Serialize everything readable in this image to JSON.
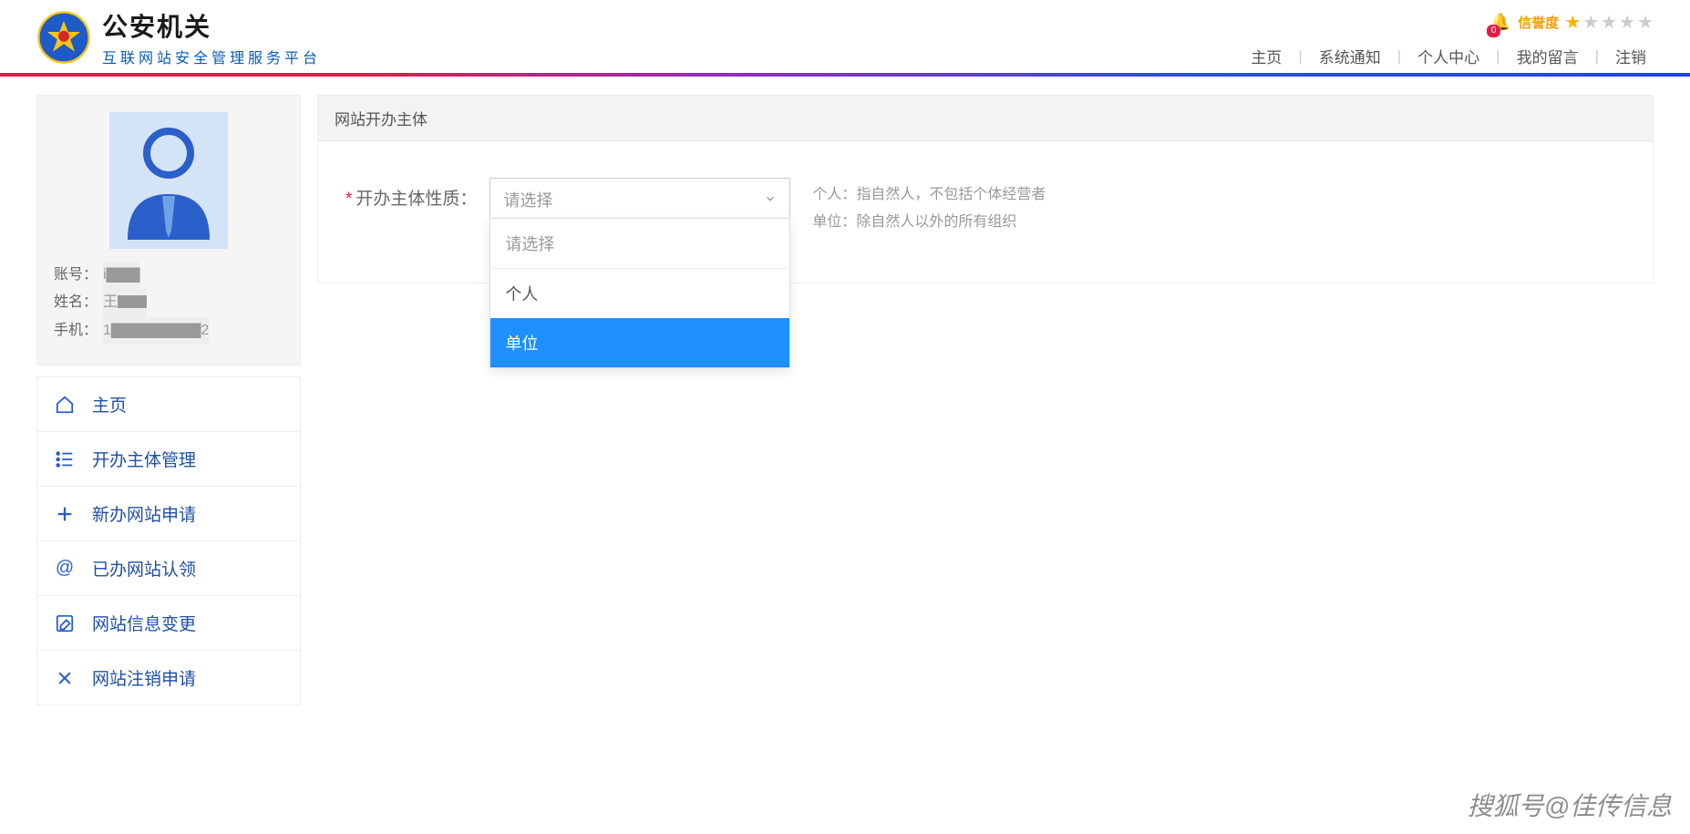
{
  "header": {
    "title": "公安机关",
    "subtitle": "互联网站安全管理服务平台",
    "credit_label": "信誉度",
    "badge_count": "0",
    "nav": [
      "主页",
      "系统通知",
      "个人中心",
      "我的留言",
      "注销"
    ]
  },
  "user": {
    "account_label": "账号：",
    "account_value": "i▇▇▇",
    "name_label": "姓名：",
    "name_value": "王▇▇",
    "phone_label": "手机：",
    "phone_value": "1▇▇▇▇▇▇▇▇2"
  },
  "menu": [
    {
      "icon": "home",
      "label": "主页"
    },
    {
      "icon": "list",
      "label": "开办主体管理"
    },
    {
      "icon": "plus",
      "label": "新办网站申请"
    },
    {
      "icon": "at",
      "label": "已办网站认领"
    },
    {
      "icon": "edit",
      "label": "网站信息变更"
    },
    {
      "icon": "close",
      "label": "网站注销申请"
    }
  ],
  "main": {
    "title": "网站开办主体",
    "form_label": "开办主体性质：",
    "select_placeholder": "请选择",
    "options": [
      "请选择",
      "个人",
      "单位"
    ],
    "hint_line1": "个人：指自然人，不包括个体经营者",
    "hint_line2": "单位：除自然人以外的所有组织"
  },
  "watermark": "搜狐号@佳传信息"
}
